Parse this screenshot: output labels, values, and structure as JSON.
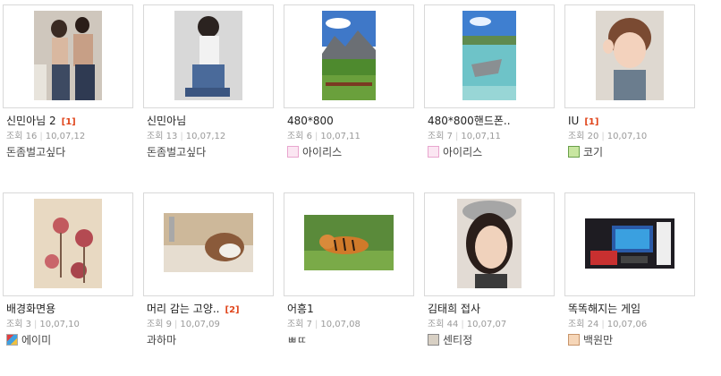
{
  "labels": {
    "views": "조회"
  },
  "items": [
    {
      "title": "신민아님 2",
      "count": "[1]",
      "views": "16",
      "date": "10,07,12",
      "author": "돈좀벌고싶다",
      "author_icon": "none"
    },
    {
      "title": "신민아님",
      "count": "",
      "views": "13",
      "date": "10,07,12",
      "author": "돈좀벌고싶다",
      "author_icon": "none"
    },
    {
      "title": "480*800",
      "count": "",
      "views": "6",
      "date": "10,07,11",
      "author": "아이리스",
      "author_icon": "pink-swirl-avatar-icon"
    },
    {
      "title": "480*800핸드폰..",
      "count": "",
      "views": "7",
      "date": "10,07,11",
      "author": "아이리스",
      "author_icon": "pink-swirl-avatar-icon"
    },
    {
      "title": "IU",
      "count": "[1]",
      "views": "20",
      "date": "10,07,10",
      "author": "코기",
      "author_icon": "green-character-avatar-icon"
    },
    {
      "title": "배경화면용",
      "count": "",
      "views": "3",
      "date": "10,07,10",
      "author": "에이미",
      "author_icon": "colorful-avatar-icon"
    },
    {
      "title": "머리 감는 고양..",
      "count": "[2]",
      "views": "9",
      "date": "10,07,09",
      "author": "과하마",
      "author_icon": "none"
    },
    {
      "title": "어흥1",
      "count": "",
      "views": "7",
      "date": "10,07,08",
      "author": "ㅃㄸ",
      "author_icon": "none"
    },
    {
      "title": "김태희 접사",
      "count": "",
      "views": "44",
      "date": "10,07,07",
      "author": "센티정",
      "author_icon": "photo-avatar-icon"
    },
    {
      "title": "똑똑해지는 게임",
      "count": "",
      "views": "24",
      "date": "10,07,06",
      "author": "백원만",
      "author_icon": "face-avatar-icon"
    }
  ]
}
